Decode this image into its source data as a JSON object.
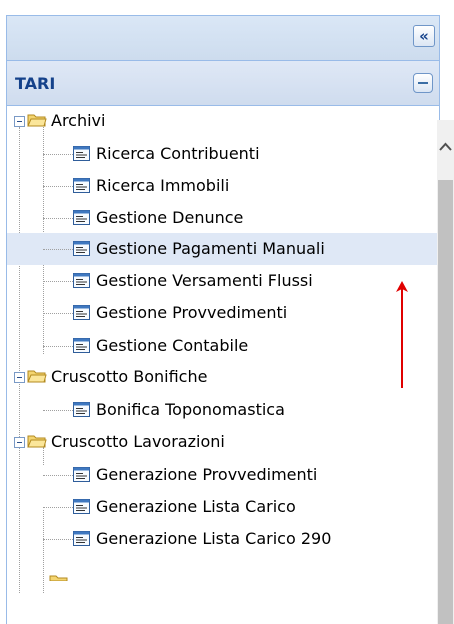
{
  "panel": {
    "collapse_glyph": "«"
  },
  "header": {
    "title": "TARI"
  },
  "tree": [
    {
      "label": "Archivi",
      "type": "folder",
      "children": [
        {
          "label": "Ricerca Contribuenti"
        },
        {
          "label": "Ricerca Immobili"
        },
        {
          "label": "Gestione Denunce"
        },
        {
          "label": "Gestione Pagamenti Manuali",
          "selected": true
        },
        {
          "label": "Gestione Versamenti Flussi"
        },
        {
          "label": "Gestione Provvedimenti"
        },
        {
          "label": "Gestione Contabile"
        }
      ]
    },
    {
      "label": "Cruscotto Bonifiche",
      "type": "folder",
      "children": [
        {
          "label": "Bonifica Toponomastica"
        }
      ]
    },
    {
      "label": "Cruscotto Lavorazioni",
      "type": "folder",
      "children": [
        {
          "label": "Generazione Provvedimenti"
        },
        {
          "label": "Generazione Lista Carico"
        },
        {
          "label": "Generazione Lista Carico 290"
        }
      ]
    }
  ],
  "colors": {
    "selected_row": "#dfe8f6",
    "annotation_arrow": "#e00000",
    "header_text": "#15428b"
  }
}
